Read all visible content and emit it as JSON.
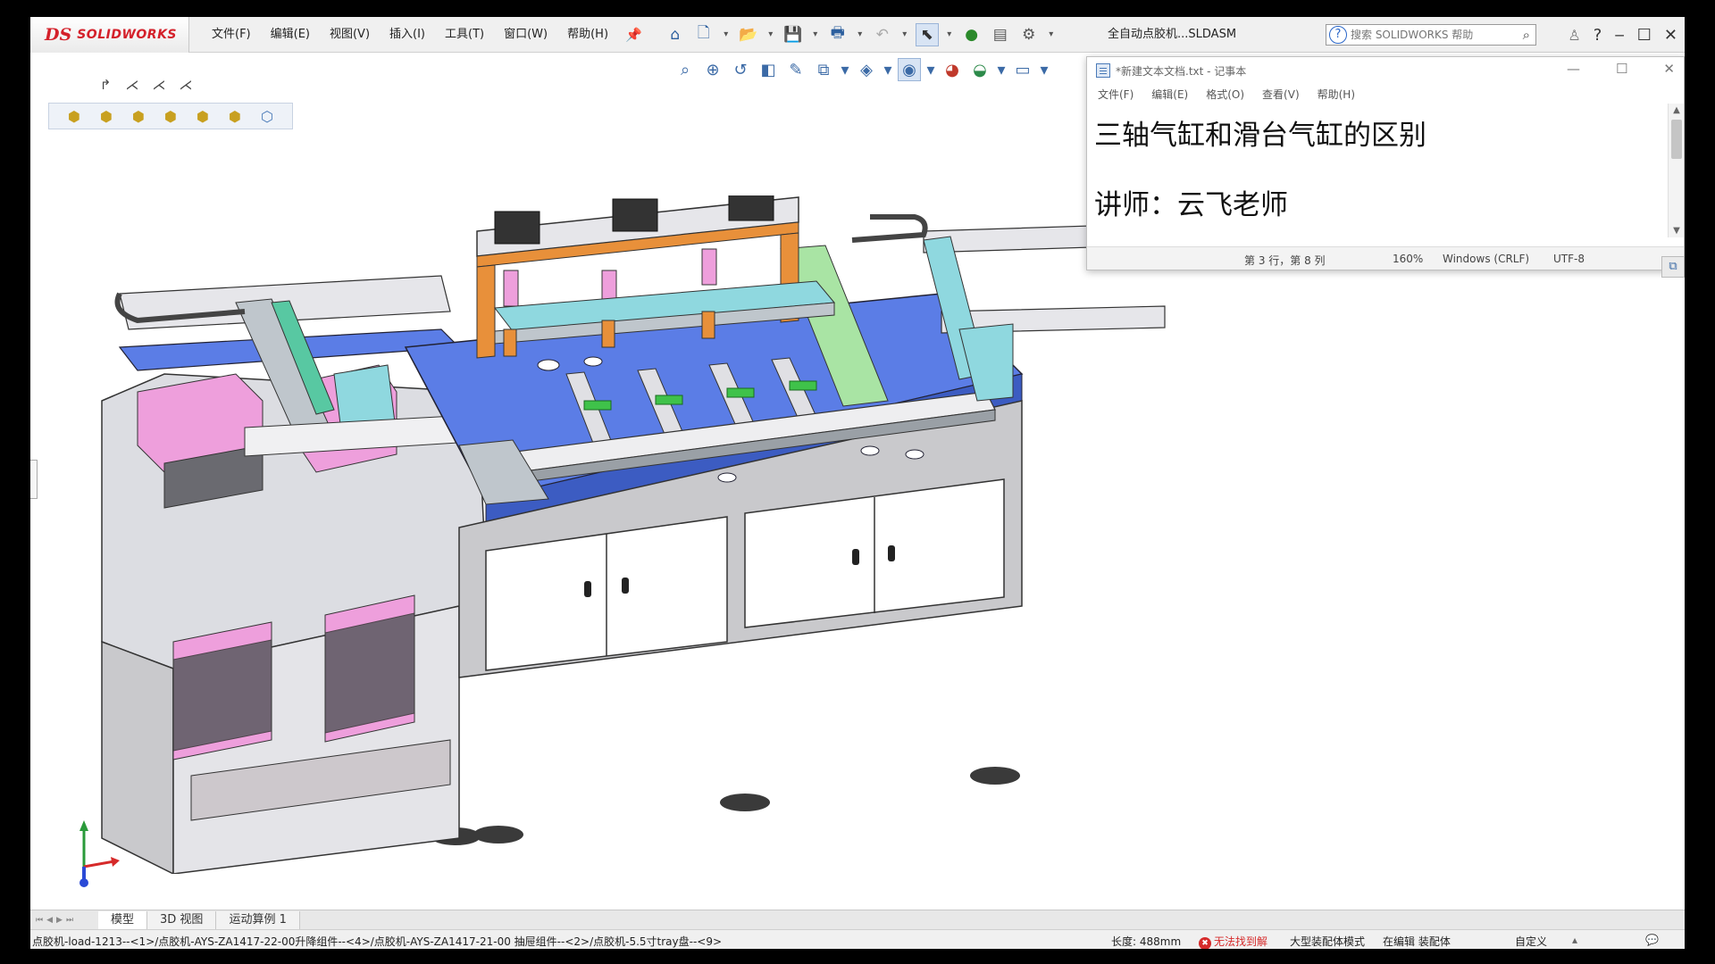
{
  "app": {
    "brand_ds": "DS",
    "brand_name": "SOLIDWORKS",
    "doc_title": "全自动点胶机...SLDASM"
  },
  "menu": [
    "文件(F)",
    "编辑(E)",
    "视图(V)",
    "插入(I)",
    "工具(T)",
    "窗口(W)",
    "帮助(H)"
  ],
  "help_search": {
    "placeholder": "搜索 SOLIDWORKS 帮助"
  },
  "notepad": {
    "title": "*新建文本文档.txt - 记事本",
    "menu": [
      "文件(F)",
      "编辑(E)",
      "格式(O)",
      "查看(V)",
      "帮助(H)"
    ],
    "lines": [
      "三轴气缸和滑台气缸的区别",
      "讲师：云飞老师"
    ],
    "status": {
      "position": "第 3 行，第 8 列",
      "zoom": "160%",
      "line_ending": "Windows (CRLF)",
      "encoding": "UTF-8"
    }
  },
  "tabs": [
    "模型",
    "3D 视图",
    "运动算例 1"
  ],
  "status_bar": {
    "path": "点胶机-load-1213--<1>/点胶机-AYS-ZA1417-22-00升降组件--<4>/点胶机-AYS-ZA1417-21-00 抽屉组件--<2>/点胶机-5.5寸tray盘--<9>",
    "length": "长度: 488mm",
    "error": "无法找到解",
    "mode": "大型装配体模式",
    "editing": "在编辑 装配体",
    "custom": "自定义"
  },
  "colors": {
    "plate_blue": "#5b7de6",
    "tray_pink": "#ee9fdc",
    "belt_green": "#a9e4a4",
    "bracket_cyan": "#8fd8df",
    "cabinet_white": "#ffffff",
    "frame_grey": "#c9c9cc",
    "error_red": "#d62a2a"
  },
  "icons": {
    "title_right": [
      "user-icon",
      "help-icon",
      "minimize-icon",
      "maximize-icon",
      "close-icon"
    ],
    "std_toolbar": [
      "home-icon",
      "new-document-icon",
      "open-icon",
      "save-icon",
      "print-icon",
      "undo-icon",
      "select-icon",
      "traffic-light-icon",
      "file-properties-icon",
      "options-gear-icon"
    ],
    "view_toolbar": [
      "zoom-to-fit-icon",
      "zoom-area-icon",
      "previous-view-icon",
      "section-view-icon",
      "dynamic-annotation-icon",
      "view-orientation-icon",
      "display-style-icon",
      "hide-show-icon",
      "edit-appearance-icon",
      "apply-scene-icon",
      "view-settings-icon"
    ]
  }
}
